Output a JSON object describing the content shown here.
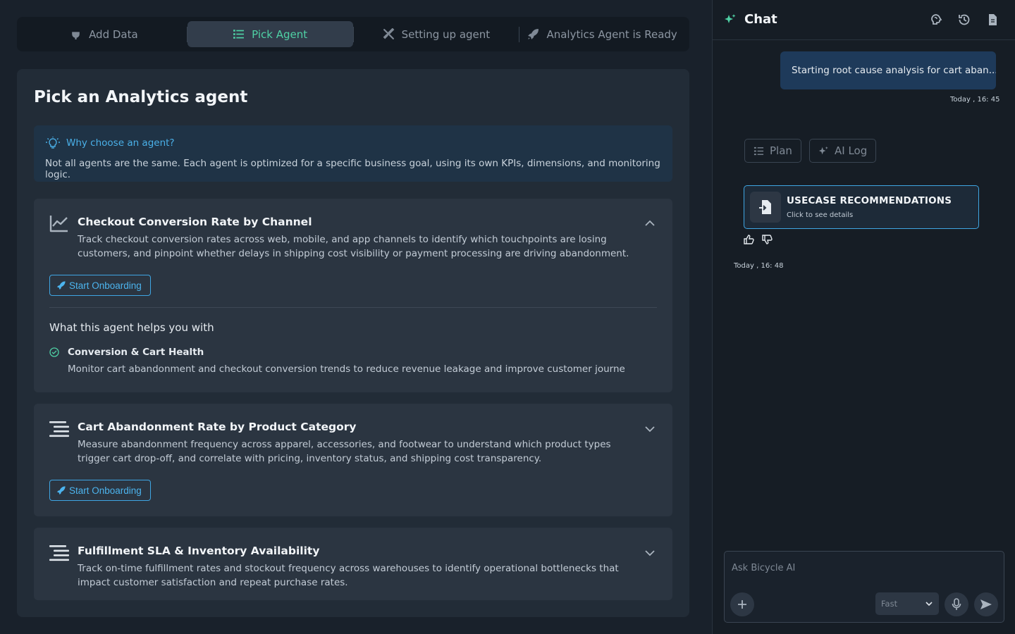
{
  "stepper": {
    "steps": [
      {
        "label": "Add Data",
        "icon": "plug-icon"
      },
      {
        "label": "Pick Agent",
        "icon": "list-icon"
      },
      {
        "label": "Setting up agent",
        "icon": "tools-icon"
      },
      {
        "label": "Analytics Agent is Ready",
        "icon": "rocket-icon"
      }
    ],
    "active_index": 1
  },
  "panel": {
    "title": "Pick an Analytics agent",
    "info": {
      "heading": "Why choose an agent?",
      "body": "Not all agents are the same. Each agent is optimized for a specific business goal, using its own KPIs, dimensions, and monitoring logic."
    },
    "agents": [
      {
        "title": "Checkout Conversion Rate by Channel",
        "description": "Track checkout conversion rates across web, mobile, and app channels to identify which touchpoints are losing customers, and pinpoint whether delays in shipping cost visibility or payment processing are driving abandonment.",
        "button": "Start Onboarding",
        "expanded": true,
        "helps_title": "What this agent helps you with",
        "helps_item_title": "Conversion & Cart Health",
        "helps_item_desc": "Monitor cart abandonment and checkout conversion trends to reduce revenue leakage and improve customer journey visib..."
      },
      {
        "title": "Cart Abandonment Rate by Product Category",
        "description": "Measure abandonment frequency across apparel, accessories, and footwear to understand which product types trigger cart drop-off, and correlate with pricing, inventory status, and shipping cost transparency.",
        "button": "Start Onboarding",
        "expanded": false
      },
      {
        "title": "Fulfillment SLA & Inventory Availability",
        "description": "Track on-time fulfillment rates and stockout frequency across warehouses to identify operational bottlenecks that impact customer satisfaction and repeat purchase rates.",
        "expanded": false
      }
    ]
  },
  "chat": {
    "title": "Chat",
    "user_message": "Starting root cause analysis for cart aban...",
    "user_timestamp": "Today , 16: 45",
    "plan_label": "Plan",
    "ailog_label": "AI Log",
    "usecase_title": "USECASE RECOMMENDATIONS",
    "usecase_sub": "Click to see details",
    "bot_timestamp": "Today , 16: 48",
    "input_placeholder": "Ask Bicycle AI",
    "mode": "Fast"
  },
  "colors": {
    "accent_green": "#4fd1a5",
    "accent_blue": "#3fa6e3",
    "background": "#19212b"
  }
}
